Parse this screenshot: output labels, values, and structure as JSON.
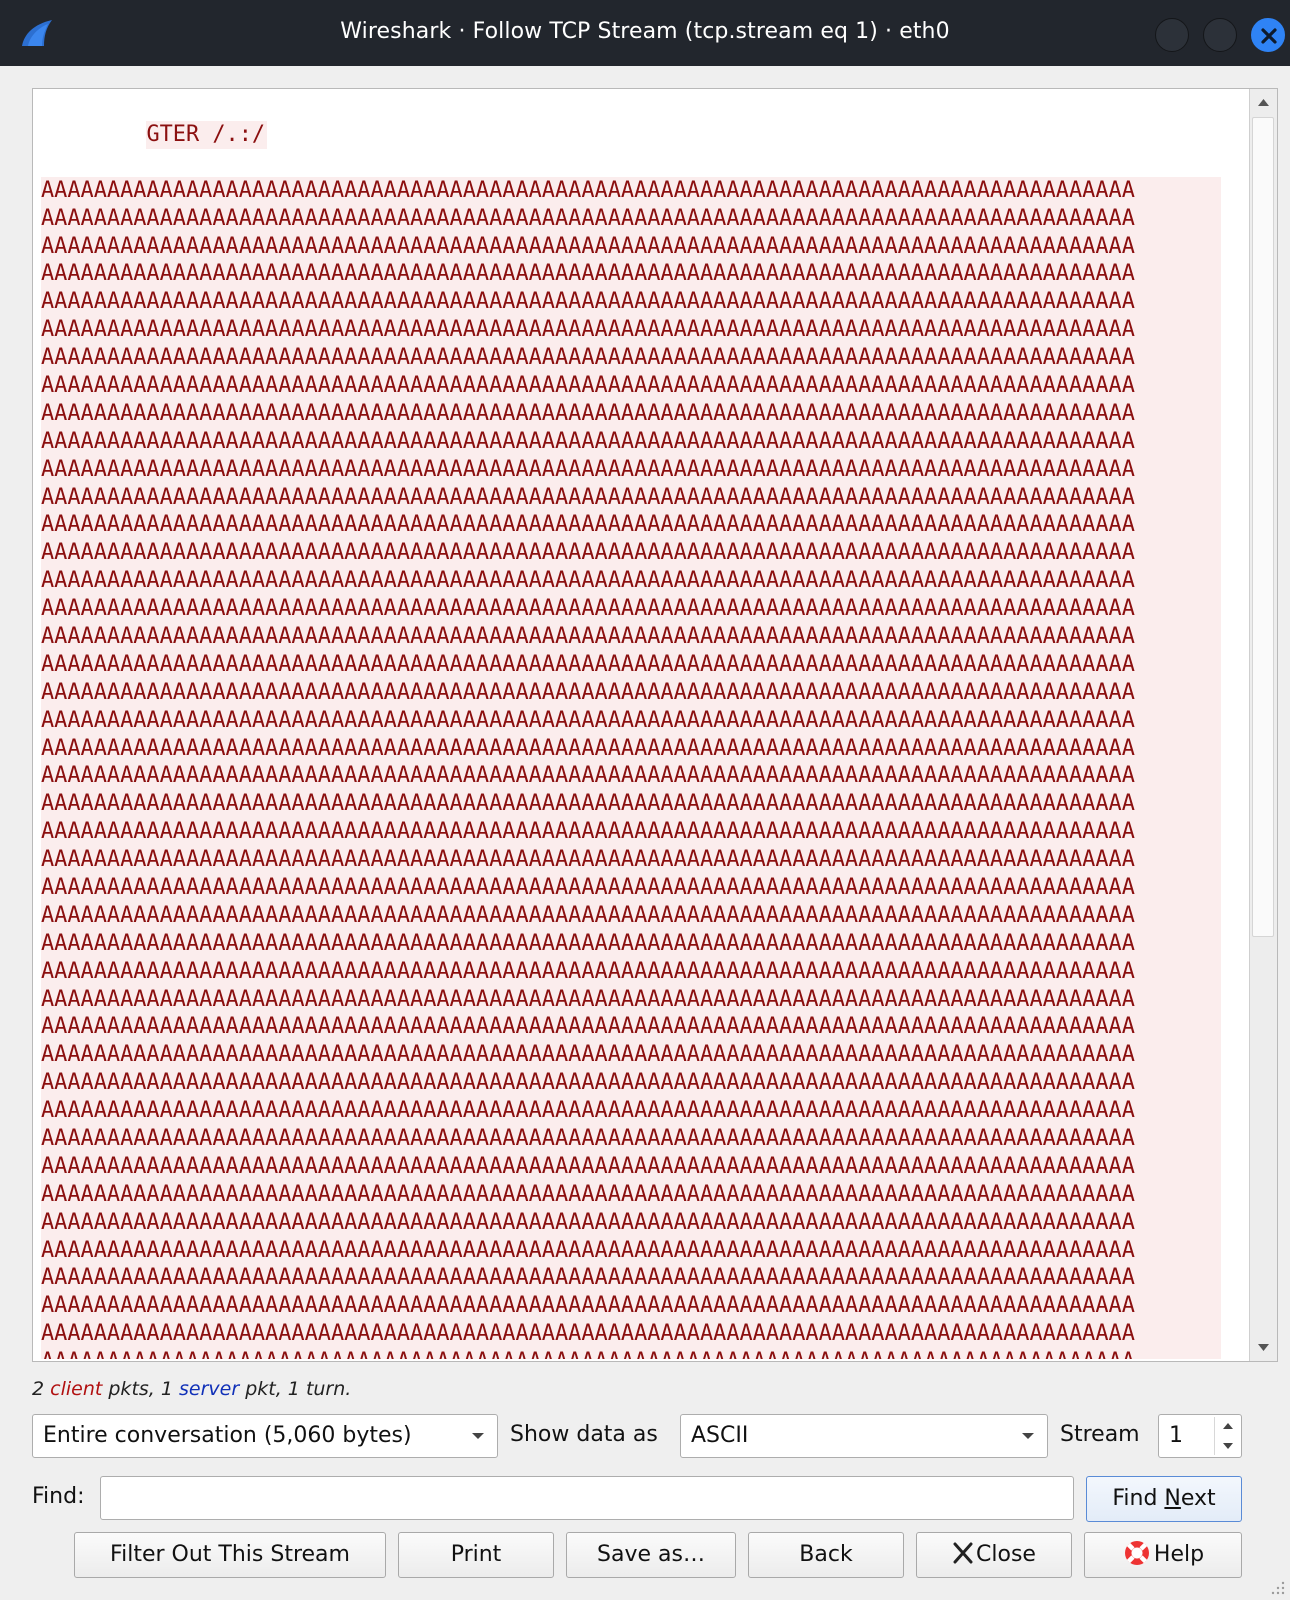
{
  "window": {
    "title": "Wireshark · Follow TCP Stream (tcp.stream eq 1) · eth0"
  },
  "stream": {
    "first_line": "GTER /.:/",
    "repeat_char": "A",
    "chars_per_line": 83,
    "visible_lines": 45
  },
  "status": {
    "client_count": "2",
    "client_word": "client",
    "middle": "pkts, 1",
    "server_word": "server",
    "tail": "pkt, 1 turn."
  },
  "controls": {
    "conversation_value": "Entire conversation (5,060 bytes)",
    "show_data_label": "Show data as",
    "show_data_value": "ASCII",
    "stream_label": "Stream",
    "stream_value": "1",
    "find_label": "Find:",
    "find_value": "",
    "find_next_pre": "Find ",
    "find_next_underlined": "N",
    "find_next_post": "ext"
  },
  "buttons": {
    "filter_out": "Filter Out This Stream",
    "print": "Print",
    "save_as": "Save as…",
    "back": "Back",
    "close": "Close",
    "help": "Help"
  },
  "colors": {
    "client_text": "#8b0f0f",
    "client_bg": "#fbeded",
    "server_text": "#1030b8",
    "titlebar": "#22262d",
    "close_accent": "#2f83f5"
  },
  "icons": {
    "app_logo": "wireshark-fin-icon",
    "window_close": "close-x-icon",
    "dropdown": "chevron-down-icon",
    "close_button": "x-icon",
    "help_button": "lifebuoy-icon"
  }
}
